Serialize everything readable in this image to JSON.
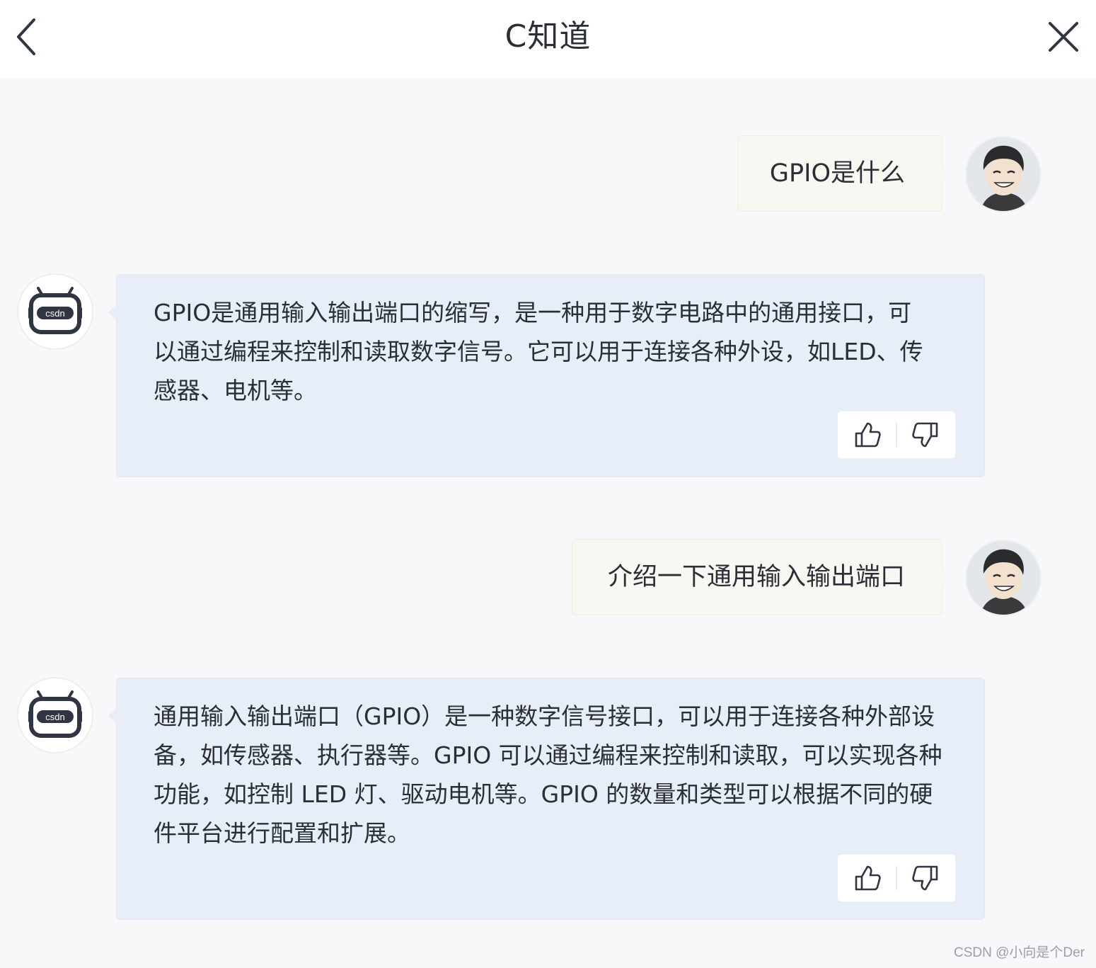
{
  "header": {
    "title": "C知道",
    "back_icon": "chevron-left-icon",
    "close_icon": "close-icon"
  },
  "messages": [
    {
      "role": "user",
      "text": "GPIO是什么"
    },
    {
      "role": "assistant",
      "text": "GPIO是通用输入输出端口的缩写，是一种用于数字电路中的通用接口，可以通过编程来控制和读取数字信号。它可以用于连接各种外设，如LED、传感器、电机等。"
    },
    {
      "role": "user",
      "text": "介绍一下通用输入输出端口"
    },
    {
      "role": "assistant",
      "text": "通用输入输出端口（GPIO）是一种数字信号接口，可以用于连接各种外部设备，如传感器、执行器等。GPIO 可以通过编程来控制和读取，可以实现各种功能，如控制 LED 灯、驱动电机等。GPIO 的数量和类型可以根据不同的硬件平台进行配置和扩展。"
    }
  ],
  "bot_avatar_label": "csdn",
  "watermark": "CSDN @小向是个Der",
  "colors": {
    "header_bg": "#ffffff",
    "page_bg": "#f8f8fa",
    "user_bubble_bg": "#f9f7f1",
    "bot_bubble_bg": "#e8eef8",
    "text": "#2a2f36",
    "icon": "#2f3542"
  }
}
